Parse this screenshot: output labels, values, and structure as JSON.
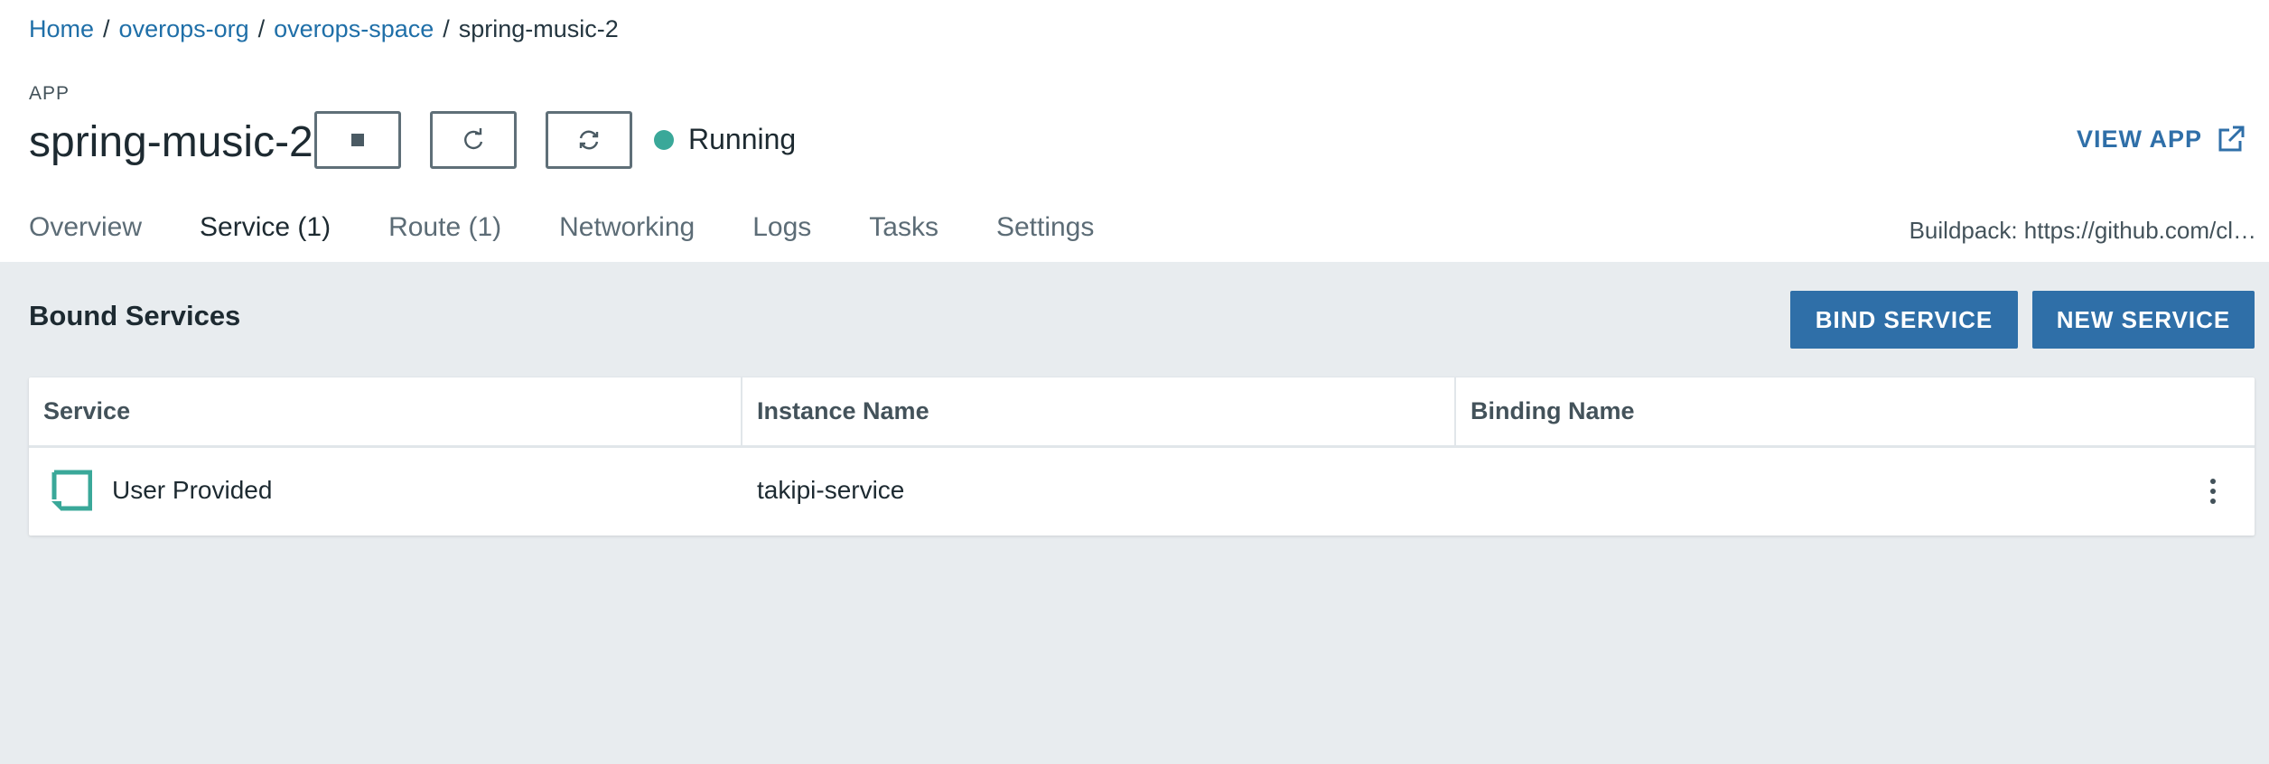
{
  "breadcrumb": {
    "items": [
      {
        "label": "Home",
        "link": true
      },
      {
        "label": "overops-org",
        "link": true
      },
      {
        "label": "overops-space",
        "link": true
      },
      {
        "label": "spring-music-2",
        "link": false
      }
    ],
    "separator": "/"
  },
  "app": {
    "label": "APP",
    "name": "spring-music-2",
    "status": "Running",
    "status_color": "#3aa899",
    "controls": [
      {
        "name": "stop-icon"
      },
      {
        "name": "restart-icon"
      },
      {
        "name": "restage-icon"
      }
    ]
  },
  "header": {
    "view_app_label": "VIEW APP",
    "view_app_icon": "external-link-icon",
    "buildpack": "Buildpack: https://github.com/cl…"
  },
  "tabs": [
    {
      "label": "Overview",
      "active": false
    },
    {
      "label": "Service (1)",
      "active": true
    },
    {
      "label": "Route (1)",
      "active": false
    },
    {
      "label": "Networking",
      "active": false
    },
    {
      "label": "Logs",
      "active": false
    },
    {
      "label": "Tasks",
      "active": false
    },
    {
      "label": "Settings",
      "active": false
    }
  ],
  "services": {
    "title": "Bound Services",
    "bind_button": "BIND SERVICE",
    "new_button": "NEW SERVICE",
    "columns": [
      "Service",
      "Instance Name",
      "Binding Name"
    ],
    "rows": [
      {
        "service": "User Provided",
        "service_icon": "user-provided-service-icon",
        "instance_name": "takipi-service",
        "binding_name": ""
      }
    ]
  },
  "colors": {
    "accent": "#3aa899",
    "primary_button": "#2f6fa8",
    "link": "#1f6fa8",
    "content_bg": "#e8ecef"
  }
}
